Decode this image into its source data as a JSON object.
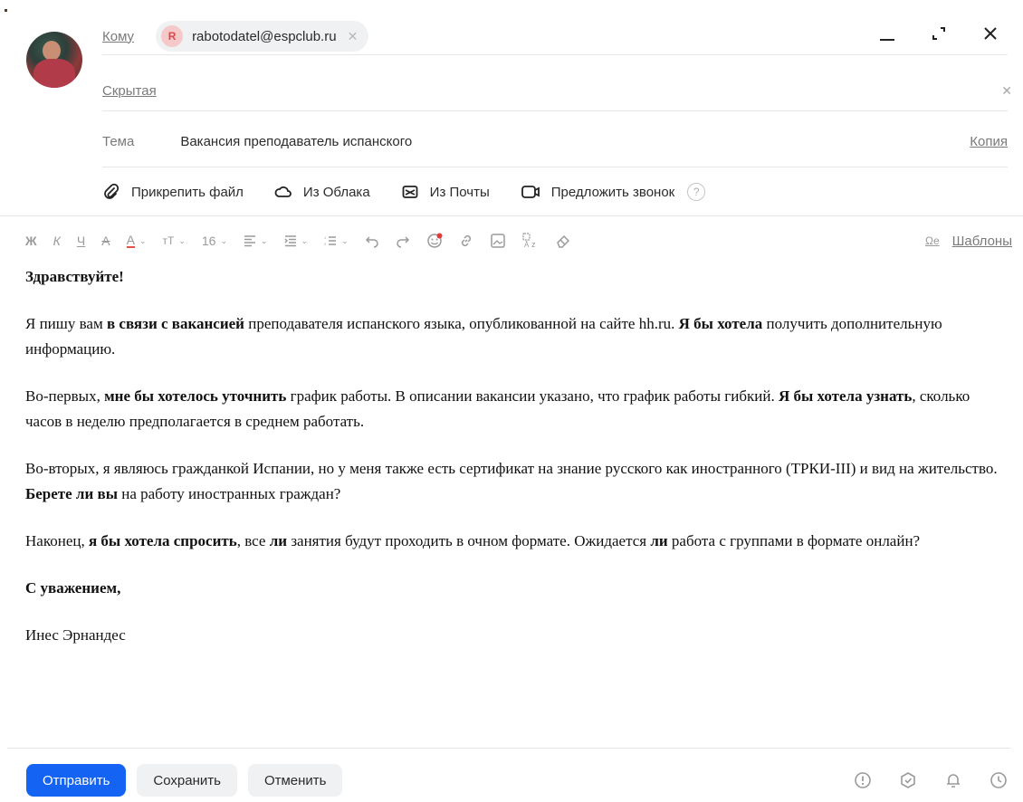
{
  "header": {
    "to_label": "Кому",
    "recipient_initial": "R",
    "recipient_email": "rabotodatel@espclub.ru",
    "bcc_label": "Скрытая",
    "subject_label": "Тема",
    "subject_value": "Вакансия преподаватель испанского",
    "copy_label": "Копия"
  },
  "attachments": {
    "attach_file": "Прикрепить файл",
    "from_cloud": "Из Облака",
    "from_mail": "Из Почты",
    "propose_call": "Предложить звонок"
  },
  "toolbar": {
    "bold": "Ж",
    "italic": "К",
    "underline": "Ч",
    "strike": "А",
    "color": "А",
    "font_size": "16",
    "templates": "Шаблоны"
  },
  "body": {
    "greeting": "Здравствуйте!",
    "p1_a": "Я пишу вам ",
    "p1_b": "в связи с вакансией",
    "p1_c": " преподавателя испанского языка, опубликованной на сайте hh.ru. ",
    "p1_d": "Я бы хотела",
    "p1_e": " получить дополнительную информацию.",
    "p2_a": "Во-первых, ",
    "p2_b": "мне бы хотелось уточнить",
    "p2_c": " график работы. В описании вакансии указано, что график работы гибкий. ",
    "p2_d": "Я бы хотела узнать",
    "p2_e": ", сколько часов в неделю предполагается в среднем работать.",
    "p3_a": "Во-вторых, я являюсь гражданкой Испании, но у меня также есть сертификат на знание русского как иностранного (ТРКИ-III) и вид на жительство. ",
    "p3_b": "Берете ли вы",
    "p3_c": " на работу иностранных граждан?",
    "p4_a": "Наконец, ",
    "p4_b": "я бы хотела спросить",
    "p4_c": ", все ",
    "p4_d": "ли",
    "p4_e": " занятия будут проходить в очном формате. Ожидается ",
    "p4_f": "ли",
    "p4_g": " работа с группами в формате онлайн?",
    "closing": "С уважением,",
    "signature": "Инес Эрнандес"
  },
  "footer": {
    "send": "Отправить",
    "save": "Сохранить",
    "cancel": "Отменить"
  },
  "colors": {
    "primary": "#1463f3",
    "chip_bg": "#f0f1f3",
    "notification_dot": "#e53935"
  }
}
